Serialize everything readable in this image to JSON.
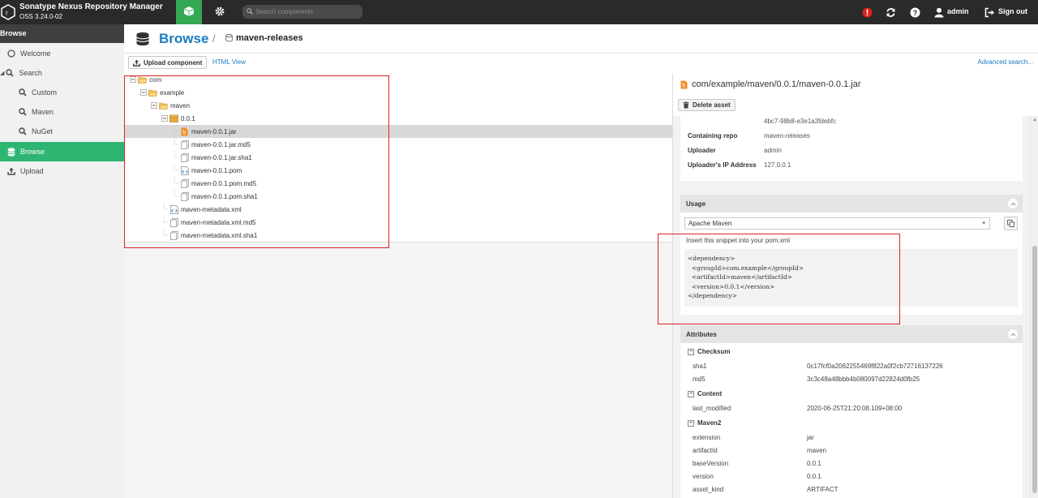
{
  "header": {
    "app_title": "Sonatype Nexus Repository Manager",
    "version": "OSS 3.24.0-02",
    "search_placeholder": "Search components",
    "user": "admin",
    "sign_out": "Sign out"
  },
  "leftnav": {
    "header": "Browse",
    "items": [
      {
        "label": "Welcome",
        "icon": "circle-icon"
      },
      {
        "label": "Search",
        "icon": "search-icon"
      },
      {
        "label": "Custom",
        "icon": "search-icon"
      },
      {
        "label": "Maven",
        "icon": "search-icon"
      },
      {
        "label": "NuGet",
        "icon": "search-icon"
      },
      {
        "label": "Browse",
        "icon": "database-icon"
      },
      {
        "label": "Upload",
        "icon": "upload-icon"
      }
    ]
  },
  "breadcrumb": {
    "title": "Browse",
    "separator": "/",
    "repo": "maven-releases"
  },
  "toolbar": {
    "upload_label": "Upload component",
    "html_view": "HTML View",
    "advanced_search": "Advanced search..."
  },
  "tree": [
    {
      "label": "com",
      "type": "folder-open",
      "depth": 0
    },
    {
      "label": "example",
      "type": "folder-open",
      "depth": 1
    },
    {
      "label": "maven",
      "type": "folder-open",
      "depth": 2
    },
    {
      "label": "0.0.1",
      "type": "component",
      "depth": 3
    },
    {
      "label": "maven-0.0.1.jar",
      "type": "jar",
      "depth": 4,
      "selected": true
    },
    {
      "label": "maven-0.0.1.jar.md5",
      "type": "file",
      "depth": 4
    },
    {
      "label": "maven-0.0.1.jar.sha1",
      "type": "file",
      "depth": 4
    },
    {
      "label": "maven-0.0.1.pom",
      "type": "xml",
      "depth": 4
    },
    {
      "label": "maven-0.0.1.pom.md5",
      "type": "file",
      "depth": 4
    },
    {
      "label": "maven-0.0.1.pom.sha1",
      "type": "file",
      "depth": 4
    },
    {
      "label": "maven-metadata.xml",
      "type": "xml",
      "depth": 3
    },
    {
      "label": "maven-metadata.xml.md5",
      "type": "file",
      "depth": 3
    },
    {
      "label": "maven-metadata.xml.sha1",
      "type": "file",
      "depth": 3
    }
  ],
  "asset": {
    "path": "com/example/maven/0.0.1/maven-0.0.1.jar",
    "delete_label": "Delete asset",
    "summary": [
      {
        "key": "",
        "value": "4bc7-98b8-e3e1a3fdebfc"
      },
      {
        "key": "Containing repo",
        "value": "maven-releases"
      },
      {
        "key": "Uploader",
        "value": "admin"
      },
      {
        "key": "Uploader's IP Address",
        "value": "127.0.0.1"
      }
    ]
  },
  "usage": {
    "title": "Usage",
    "format": "Apache Maven",
    "hint": "Insert this snippet into your pom.xml",
    "snippet": "<dependency>\n  <groupId>com.example</groupId>\n  <artifactId>maven</artifactId>\n  <version>0.0.1</version>\n</dependency>"
  },
  "attributes": {
    "title": "Attributes",
    "groups": [
      {
        "name": "Checksum",
        "rows": [
          {
            "k": "sha1",
            "v": "0c17fcf0a2062255469f822a0f2cb72716137226"
          },
          {
            "k": "md5",
            "v": "3c3c48a48bbb4b080097d22824d0fb25"
          }
        ]
      },
      {
        "name": "Content",
        "rows": [
          {
            "k": "last_modified",
            "v": "2020-06-25T21:20:08.109+08:00"
          }
        ]
      },
      {
        "name": "Maven2",
        "rows": [
          {
            "k": "extension",
            "v": "jar"
          },
          {
            "k": "artifactId",
            "v": "maven"
          },
          {
            "k": "baseVersion",
            "v": "0.0.1"
          },
          {
            "k": "version",
            "v": "0.0.1"
          },
          {
            "k": "asset_kind",
            "v": "ARTIFACT"
          }
        ]
      }
    ]
  },
  "colors": {
    "topbar": "#2a2a2a",
    "accent_green": "#2fb572",
    "link_blue": "#1a7bc1",
    "highlight_red": "#e02020"
  }
}
